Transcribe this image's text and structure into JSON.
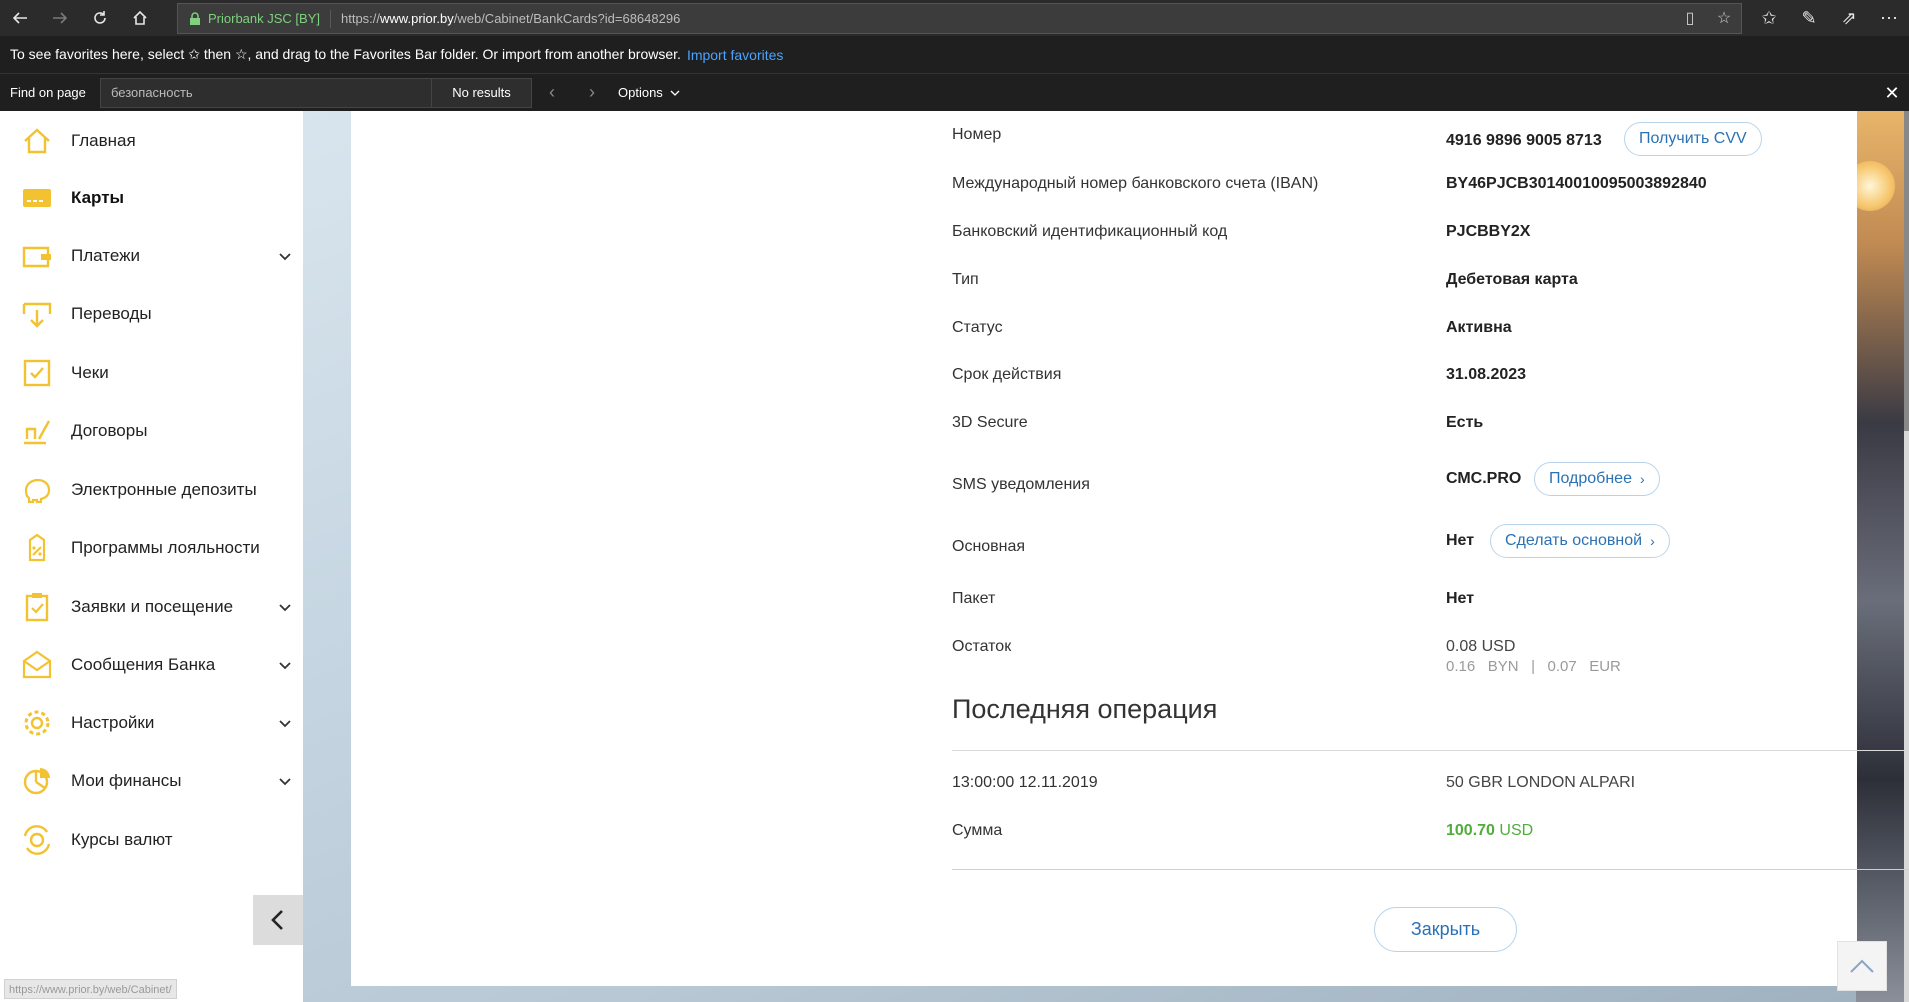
{
  "browser": {
    "site_identity": "Priorbank JSC [BY]",
    "url_prefix": "https://",
    "url_domain": "www.prior.by",
    "url_path": "/web/Cabinet/BankCards?id=68648296",
    "favorites_bar": {
      "message": "To see favorites here, select ✩ then ☆, and drag to the Favorites Bar folder. Or import from another browser.",
      "link": "Import favorites"
    },
    "find": {
      "label": "Find on page",
      "query": "безопасность",
      "results": "No results",
      "options": "Options"
    },
    "status_url": "https://www.prior.by/web/Cabinet/"
  },
  "sidebar": {
    "items": [
      {
        "label": "Главная"
      },
      {
        "label": "Карты"
      },
      {
        "label": "Платежи"
      },
      {
        "label": "Переводы"
      },
      {
        "label": "Чеки"
      },
      {
        "label": "Договоры"
      },
      {
        "label": "Электронные депозиты"
      },
      {
        "label": "Программы лояльности"
      },
      {
        "label": "Заявки и посещение"
      },
      {
        "label": "Сообщения Банка"
      },
      {
        "label": "Настройки"
      },
      {
        "label": "Мои финансы"
      },
      {
        "label": "Курсы валют"
      }
    ]
  },
  "card_details": {
    "number": {
      "label": "Номер",
      "value": "4916 9896 9005 8713",
      "action": "Получить CVV"
    },
    "iban": {
      "label": "Международный номер банковского счета (IBAN)",
      "value": "BY46PJCB30140010095003892840"
    },
    "bic": {
      "label": "Банковский идентификационный код",
      "value": "PJCBBY2X"
    },
    "type": {
      "label": "Тип",
      "value": "Дебетовая карта"
    },
    "status": {
      "label": "Статус",
      "value": "Активна"
    },
    "expiry": {
      "label": "Срок действия",
      "value": "31.08.2023"
    },
    "secure3d": {
      "label": "3D Secure",
      "value": "Есть"
    },
    "sms": {
      "label": "SMS уведомления",
      "value": "СМС.PRO",
      "action": "Подробнее"
    },
    "primary": {
      "label": "Основная",
      "value": "Нет",
      "action": "Сделать основной"
    },
    "package": {
      "label": "Пакет",
      "value": "Нет"
    },
    "balance": {
      "label": "Остаток",
      "value": "0.08 USD",
      "byn_amount": "0.16",
      "byn_currency": "BYN",
      "separator": "|",
      "eur_amount": "0.07",
      "eur_currency": "EUR"
    }
  },
  "last_operation": {
    "title": "Последняя операция",
    "datetime": "13:00:00 12.11.2019",
    "merchant": "50 GBR LONDON ALPARI",
    "amount_label": "Сумма",
    "amount": "100.70",
    "currency": "USD"
  },
  "close_button": "Закрыть",
  "colors": {
    "accent_blue": "#2a72b5",
    "icon_yellow": "#f2c230",
    "amount_green": "#4fae3b"
  }
}
